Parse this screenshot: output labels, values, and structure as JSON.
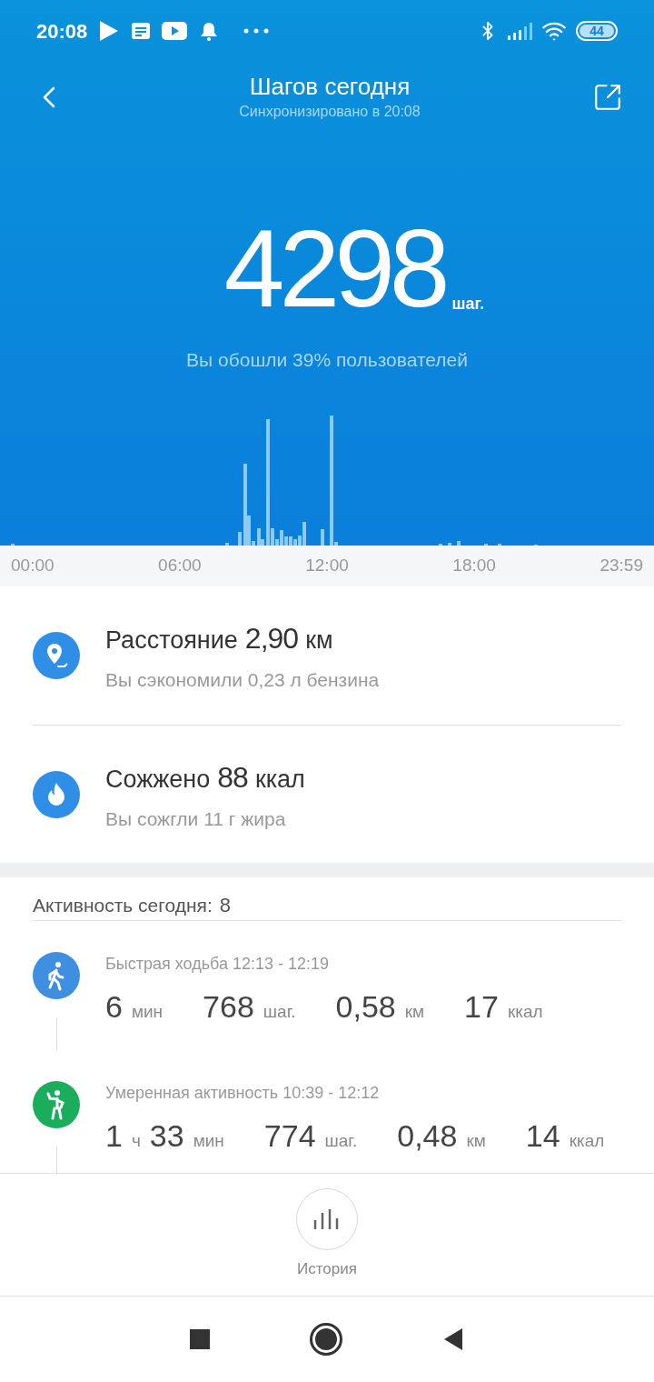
{
  "status_bar": {
    "time": "20:08",
    "battery": "44"
  },
  "header": {
    "title": "Шагов сегодня",
    "subtitle": "Синхронизировано в 20:08"
  },
  "summary": {
    "steps": "4298",
    "unit": "шаг.",
    "comparison": "Вы обошли 39% пользователей"
  },
  "time_axis": [
    "00:00",
    "06:00",
    "12:00",
    "18:00",
    "23:59"
  ],
  "stats": [
    {
      "kind": "distance",
      "label": "Расстояние",
      "value": "2,90",
      "unit": "км",
      "note": "Вы сэкономили 0,23 л бензина"
    },
    {
      "kind": "calories",
      "label": "Сожжено",
      "value": "88",
      "unit": "ккал",
      "note": "Вы сожгли 11 г жира"
    }
  ],
  "activity": {
    "label": "Активность сегодня:",
    "count": "8",
    "items": [
      {
        "kind": "brisk_walk",
        "color": "#3f8fe0",
        "title": "Быстрая ходьба 12:13 - 12:19",
        "stats": [
          [
            {
              "value": "6",
              "unit": "мин"
            }
          ],
          [
            {
              "value": "768",
              "unit": "шаг."
            }
          ],
          [
            {
              "value": "0,58",
              "unit": "км"
            }
          ],
          [
            {
              "value": "17",
              "unit": "ккал"
            }
          ]
        ]
      },
      {
        "kind": "moderate",
        "color": "#1aae5c",
        "title": "Умеренная активность 10:39 - 12:12",
        "stats": [
          [
            {
              "value": "1",
              "unit": "ч"
            },
            {
              "value": "33",
              "unit": "мин"
            }
          ],
          [
            {
              "value": "774",
              "unit": "шаг."
            }
          ],
          [
            {
              "value": "0,48",
              "unit": "км"
            }
          ],
          [
            {
              "value": "14",
              "unit": "ккал"
            }
          ]
        ]
      }
    ]
  },
  "bottom_nav": {
    "label": "История"
  }
}
